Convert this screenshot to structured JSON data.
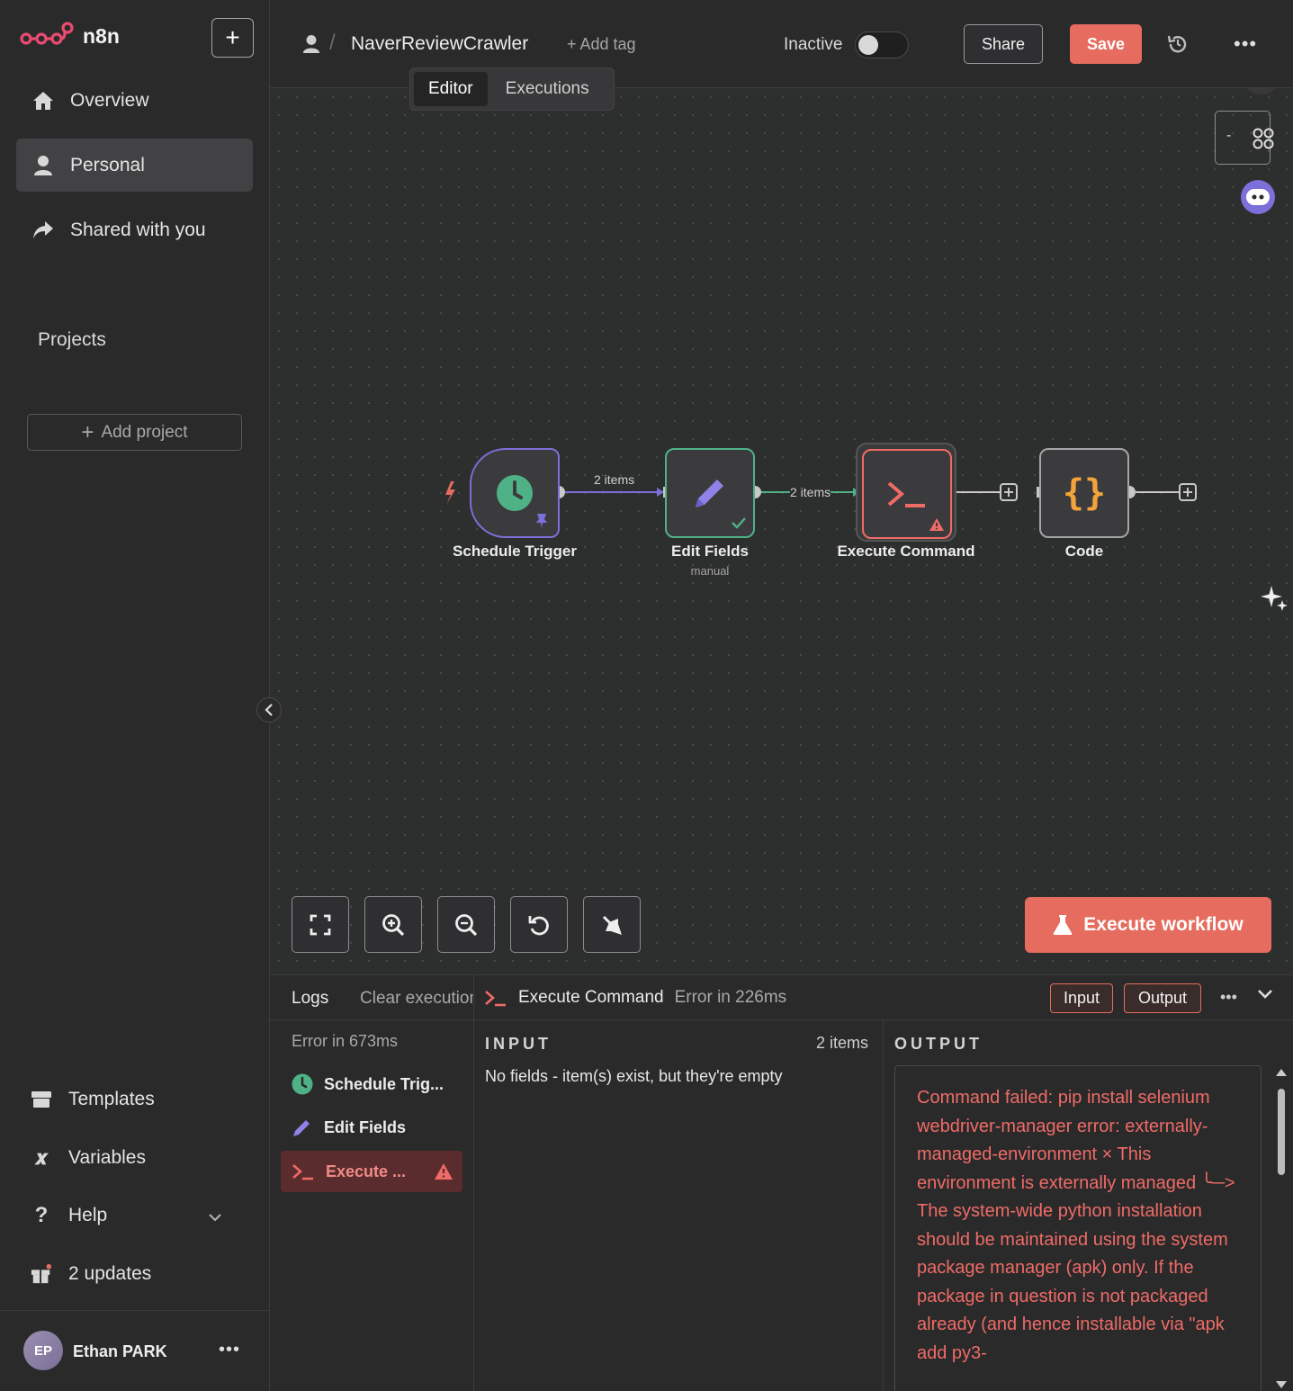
{
  "app": {
    "name": "n8n"
  },
  "sidebar": {
    "nav": [
      {
        "label": "Overview",
        "icon": "home-icon"
      },
      {
        "label": "Personal",
        "icon": "user-icon",
        "active": true
      },
      {
        "label": "Shared with you",
        "icon": "share-icon"
      }
    ],
    "projects_label": "Projects",
    "add_project_label": "Add project",
    "bottom": [
      {
        "label": "Templates",
        "icon": "templates-icon"
      },
      {
        "label": "Variables",
        "icon": "variables-icon"
      },
      {
        "label": "Help",
        "icon": "help-icon"
      },
      {
        "label": "2 updates",
        "icon": "gift-icon"
      }
    ],
    "user": {
      "initials": "EP",
      "name": "Ethan PARK"
    }
  },
  "header": {
    "workflow_name": "NaverReviewCrawler",
    "add_tag": "+ Add tag",
    "status_label": "Inactive",
    "share_label": "Share",
    "save_label": "Save",
    "tabs": [
      {
        "label": "Editor",
        "active": true
      },
      {
        "label": "Executions",
        "active": false
      }
    ]
  },
  "canvas": {
    "nodes": [
      {
        "name": "Schedule Trigger",
        "subtitle": ""
      },
      {
        "name": "Edit Fields",
        "subtitle": "manual"
      },
      {
        "name": "Execute Command",
        "subtitle": ""
      },
      {
        "name": "Code",
        "subtitle": ""
      }
    ],
    "edges": [
      {
        "label": "2 items"
      },
      {
        "label": "2 items"
      }
    ],
    "execute_workflow_label": "Execute workflow"
  },
  "colors": {
    "accent": "#e56c5e",
    "trigger": "#4fb287",
    "edit": "#7b6fd9",
    "code": "#f2a33a",
    "error": "#ef6b66"
  },
  "logs": {
    "title": "Logs",
    "clear_label": "Clear execution",
    "status": "Error in 673ms",
    "items": [
      {
        "label": "Schedule Trig...",
        "icon": "clock-icon"
      },
      {
        "label": "Edit Fields",
        "icon": "pencil-icon"
      },
      {
        "label": "Execute ...",
        "icon": "terminal-icon",
        "error": true
      }
    ]
  },
  "detail": {
    "node_name": "Execute Command",
    "status": "Error in 226ms",
    "input_btn": "Input",
    "output_btn": "Output",
    "input_label": "INPUT",
    "input_count": "2 items",
    "input_empty": "No fields - item(s) exist, but they're empty",
    "output_label": "OUTPUT",
    "error_text": "Command failed: pip install selenium webdriver-manager error: externally-managed-environment × This environment is externally managed ╰─> The system-wide python installation should be maintained using the system package manager (apk) only. If the package in question is not packaged already (and hence installable via \"apk add py3-"
  }
}
